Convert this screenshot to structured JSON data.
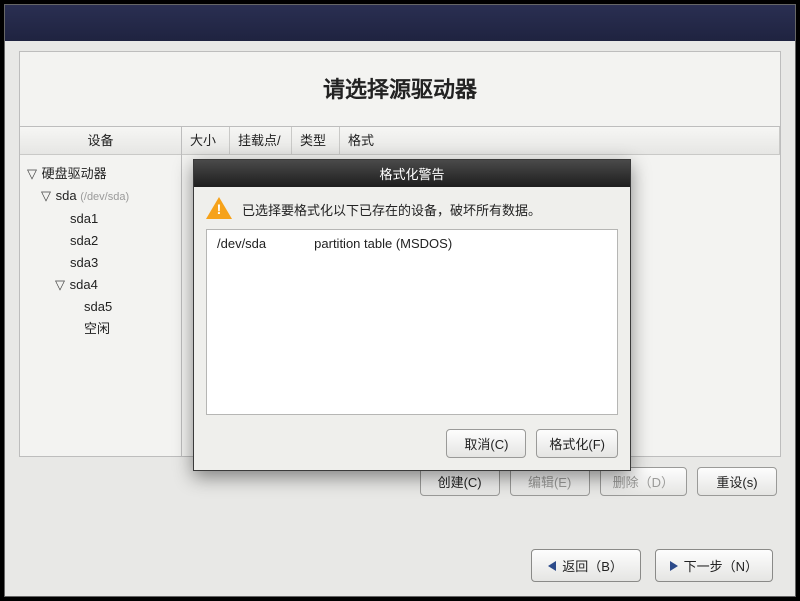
{
  "page_title": "请选择源驱动器",
  "columns": {
    "device": "设备",
    "size": "大小",
    "mount": "挂载点/",
    "type": "类型",
    "format": "格式"
  },
  "tree": {
    "root_label": "硬盘驱动器",
    "sda_label": "sda",
    "sda_hint": "(/dev/sda)",
    "items": [
      {
        "label": "sda1"
      },
      {
        "label": "sda2"
      },
      {
        "label": "sda3"
      },
      {
        "label": "sda4",
        "expandable": true
      },
      {
        "label": "sda5",
        "child": true
      },
      {
        "label": "空闲",
        "child": true
      }
    ]
  },
  "buttons": {
    "create": "创建(C)",
    "edit": "编辑(E)",
    "delete": "删除（D）",
    "reset": "重设(s)",
    "back": "返回（B）",
    "next": "下一步（N）"
  },
  "dialog": {
    "title": "格式化警告",
    "message": "已选择要格式化以下已存在的设备，破坏所有数据。",
    "device_path": "/dev/sda",
    "device_desc": "partition table (MSDOS)",
    "cancel": "取消(C)",
    "format": "格式化(F)"
  }
}
